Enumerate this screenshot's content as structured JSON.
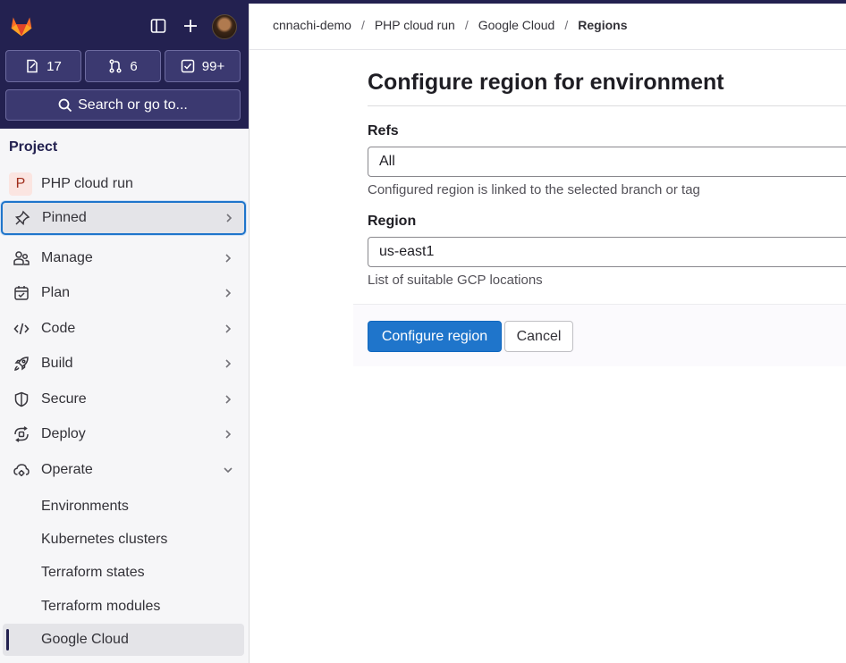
{
  "header": {
    "issues_count": "17",
    "merge_requests_count": "6",
    "todos_count": "99+",
    "search_label": "Search or go to..."
  },
  "sidebar": {
    "section_title": "Project",
    "project_badge": "P",
    "project_name": "PHP cloud run",
    "items": [
      {
        "label": "Pinned",
        "icon": "pin-icon"
      },
      {
        "label": "Manage",
        "icon": "users-icon"
      },
      {
        "label": "Plan",
        "icon": "calendar-icon"
      },
      {
        "label": "Code",
        "icon": "code-icon"
      },
      {
        "label": "Build",
        "icon": "rocket-icon"
      },
      {
        "label": "Secure",
        "icon": "shield-icon"
      },
      {
        "label": "Deploy",
        "icon": "deploy-icon"
      },
      {
        "label": "Operate",
        "icon": "cloud-gear-icon"
      }
    ],
    "operate_sub_items": [
      {
        "label": "Environments"
      },
      {
        "label": "Kubernetes clusters"
      },
      {
        "label": "Terraform states"
      },
      {
        "label": "Terraform modules"
      },
      {
        "label": "Google Cloud"
      }
    ]
  },
  "breadcrumb": {
    "items": [
      "cnnachi-demo",
      "PHP cloud run",
      "Google Cloud"
    ],
    "current": "Regions"
  },
  "main": {
    "title": "Configure region for environment",
    "refs_label": "Refs",
    "refs_value": "All",
    "refs_help": "Configured region is linked to the selected branch or tag",
    "region_label": "Region",
    "region_value": "us-east1",
    "region_help": "List of suitable GCP locations",
    "submit_label": "Configure region",
    "cancel_label": "Cancel"
  },
  "colors": {
    "sidebar_header": "#232150",
    "primary_button": "#1f75cb",
    "focus_ring": "#1f75cb"
  }
}
